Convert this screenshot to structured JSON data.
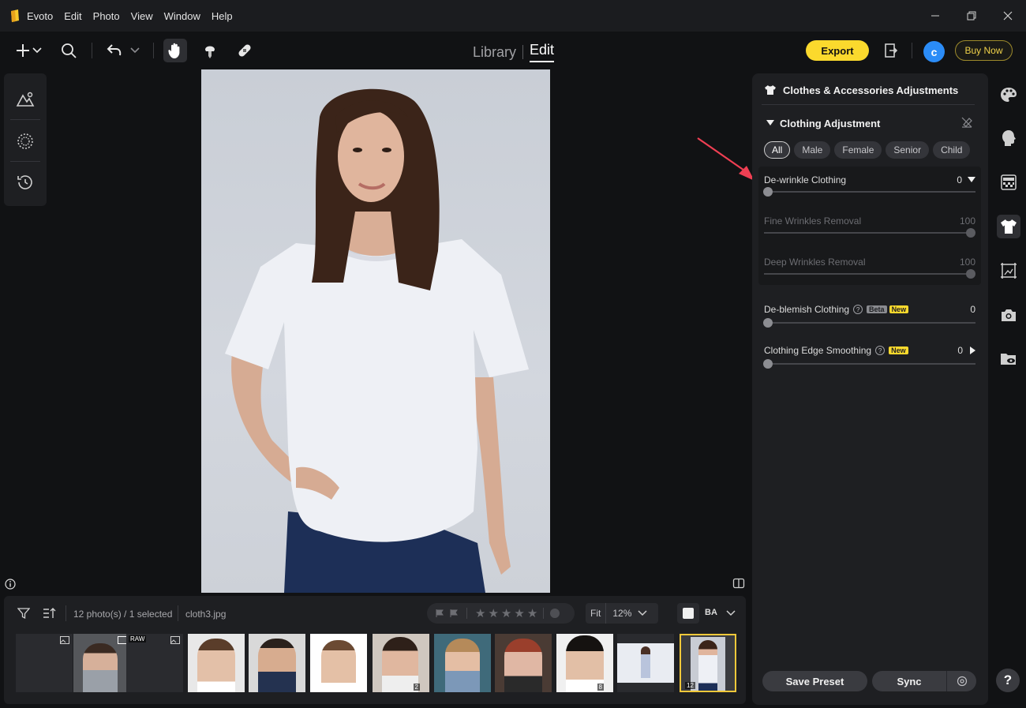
{
  "app": {
    "name": "Evoto"
  },
  "menu": [
    "Edit",
    "Photo",
    "View",
    "Window",
    "Help"
  ],
  "mode_tabs": {
    "library": "Library",
    "edit": "Edit"
  },
  "toolbar": {
    "export_label": "Export",
    "avatar_letter": "c",
    "buy_now_label": "Buy Now"
  },
  "filmstrip": {
    "photo_count": "12 photo(s) / 1 selected",
    "filename": "cloth3.jpg",
    "fit_label": "Fit",
    "zoom_label": "12%",
    "ba_label": "BA",
    "thumbs": [
      {
        "badge": "",
        "num": ""
      },
      {
        "badge": "",
        "num": ""
      },
      {
        "badge": "RAW",
        "num": ""
      },
      {
        "badge": "",
        "num": ""
      },
      {
        "badge": "",
        "num": ""
      },
      {
        "badge": "",
        "num": ""
      },
      {
        "badge": "",
        "num": "2"
      },
      {
        "badge": "",
        "num": ""
      },
      {
        "badge": "",
        "num": ""
      },
      {
        "badge": "",
        "num": "8"
      },
      {
        "badge": "",
        "num": ""
      },
      {
        "badge": "",
        "num": "12"
      }
    ]
  },
  "panel": {
    "title": "Clothes & Accessories Adjustments",
    "section_title": "Clothing Adjustment",
    "filters": [
      "All",
      "Male",
      "Female",
      "Senior",
      "Child"
    ],
    "sliders": {
      "dewrinkle": {
        "label": "De-wrinkle Clothing",
        "value": "0"
      },
      "fine": {
        "label": "Fine Wrinkles Removal",
        "value": "100"
      },
      "deep": {
        "label": "Deep Wrinkles Removal",
        "value": "100"
      },
      "deblemish": {
        "label": "De-blemish Clothing",
        "value": "0",
        "beta": "Beta",
        "new": "New"
      },
      "edge": {
        "label": "Clothing Edge Smoothing",
        "value": "0",
        "new": "New"
      }
    },
    "save_preset_label": "Save Preset",
    "sync_label": "Sync"
  },
  "help_label": "?"
}
